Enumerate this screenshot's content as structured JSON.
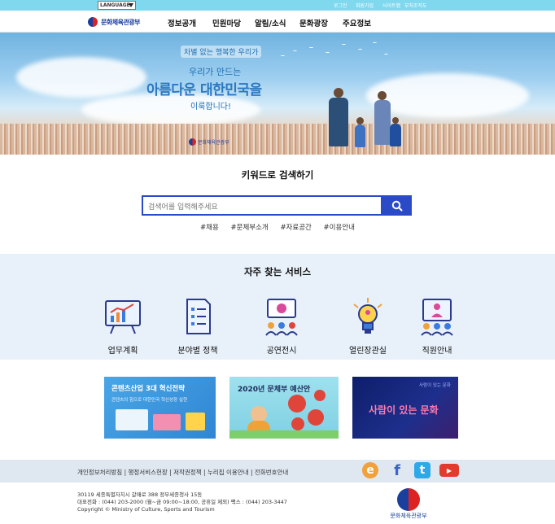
{
  "topbar": {
    "language_label": "LANGUAGE",
    "links": [
      "로그인",
      "회원가입",
      "사이트맵",
      "부처조직도"
    ]
  },
  "header": {
    "logo_text": "문화체육관광부",
    "menu": [
      "정보공개",
      "민원마당",
      "알림/소식",
      "문화광장",
      "주요정보"
    ]
  },
  "hero": {
    "line1": "차별 없는 행복한 우리가",
    "line2": "우리가 만드는",
    "headline": "아름다운 대한민국을",
    "line3": "이룩합니다!",
    "logo_text": "문화체육관광부"
  },
  "search": {
    "title": "키워드로 검색하기",
    "placeholder": "검색어를 입력해주세요",
    "tags": [
      "#채용",
      "#문체부소개",
      "#자료공간",
      "#이용안내"
    ]
  },
  "services": {
    "title": "자주 찾는 서비스",
    "items": [
      {
        "label": "업무계획",
        "icon": "chart-board-icon"
      },
      {
        "label": "분야별 정책",
        "icon": "checklist-icon"
      },
      {
        "label": "공연전시",
        "icon": "performance-icon"
      },
      {
        "label": "열린장관실",
        "icon": "lightbulb-icon"
      },
      {
        "label": "직원안내",
        "icon": "staff-icon"
      }
    ]
  },
  "banners": [
    {
      "title": "콘텐츠산업 3대 혁신전략",
      "subtitle": "콘텐츠의 힘으로 대한민국 혁신성장 실현"
    },
    {
      "title": "2020년 문체부 예산안"
    },
    {
      "title": "사람이 있는 문화",
      "subtitle": "사람이 있는 문화"
    }
  ],
  "footer": {
    "links": [
      "개인정보처리방침",
      "행정서비스헌장",
      "저작권정책",
      "누리집 이용안내",
      "전화번호안내"
    ],
    "sns": [
      {
        "icon": "blog-icon",
        "glyph": "e",
        "color": "#f2a03a"
      },
      {
        "icon": "facebook-icon",
        "glyph": "f",
        "color": "#3b65c4"
      },
      {
        "icon": "twitter-icon",
        "glyph": "t",
        "color": "#2fa8e8"
      },
      {
        "icon": "youtube-icon",
        "glyph": "▶",
        "color": "#e23b2e"
      }
    ],
    "address": "30119 세종특별자치시 갈매로 388 정부세종청사 15동",
    "contact": "대표전화 : (044) 203-2000 (월~금 09:00~18:00, 공휴일 제외) 팩스 : (044) 203-3447",
    "copyright": "Copyright © Ministry of Culture, Sports and Tourism",
    "logo_text": "문화체육관광부"
  },
  "colors": {
    "topbar": "#7fd8ee",
    "accent": "#2b4ac8",
    "services_bg": "#e8f1fa",
    "footer_bg": "#dfe7f1"
  }
}
